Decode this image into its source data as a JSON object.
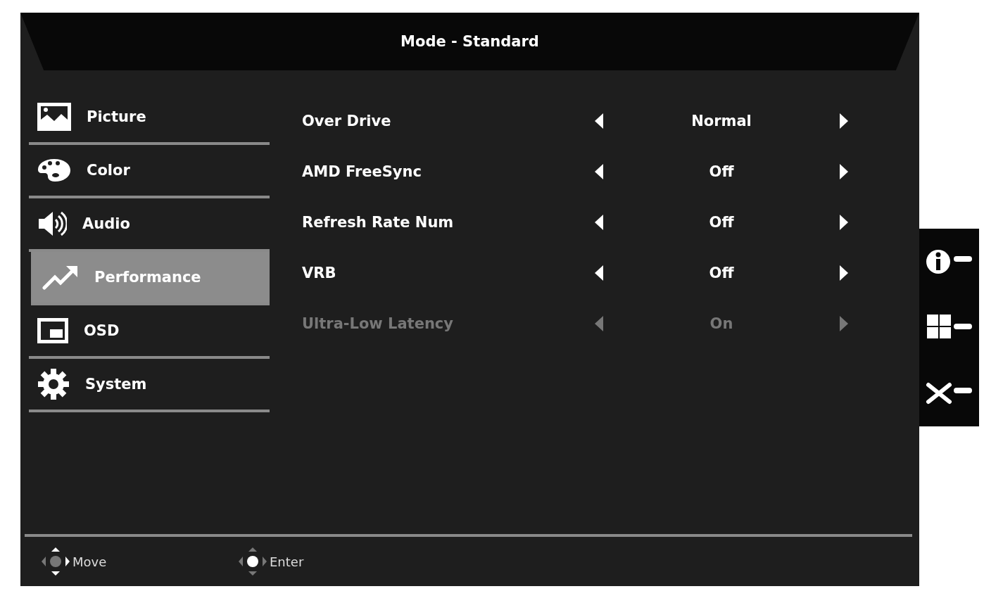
{
  "header": {
    "title": "Mode - Standard"
  },
  "menu": [
    {
      "label": "Picture",
      "selected": false
    },
    {
      "label": "Color",
      "selected": false
    },
    {
      "label": "Audio",
      "selected": false
    },
    {
      "label": "Performance",
      "selected": true
    },
    {
      "label": "OSD",
      "selected": false
    },
    {
      "label": "System",
      "selected": false
    }
  ],
  "settings": [
    {
      "label": "Over Drive",
      "value": "Normal",
      "disabled": false
    },
    {
      "label": "AMD FreeSync",
      "value": "Off",
      "disabled": false
    },
    {
      "label": "Refresh Rate Num",
      "value": "Off",
      "disabled": false
    },
    {
      "label": "VRB",
      "value": "Off",
      "disabled": false
    },
    {
      "label": "Ultra-Low Latency",
      "value": "On",
      "disabled": true
    }
  ],
  "footer": [
    {
      "label": "Move"
    },
    {
      "label": "Enter"
    }
  ]
}
